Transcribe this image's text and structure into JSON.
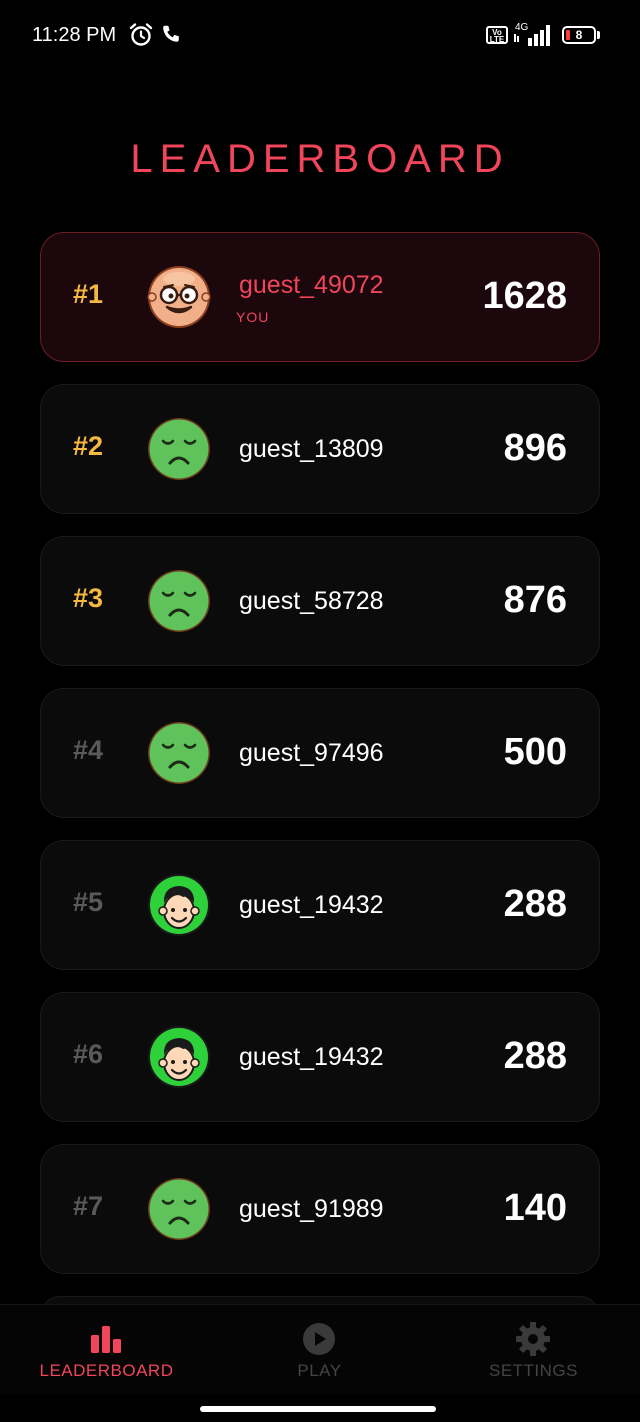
{
  "status_bar": {
    "time": "11:28 PM",
    "alarm_icon": "alarm-clock-icon",
    "call_icon": "phone-icon",
    "volte": "Vo LTE",
    "network": "4G",
    "battery": "8",
    "battery_color": "#ff3b3b"
  },
  "header": {
    "title": "LEADERBOARD"
  },
  "colors": {
    "accent": "#f0455a",
    "gold": "#f5b942",
    "muted": "#5a5a5a"
  },
  "players": [
    {
      "rank": "#1",
      "name": "guest_49072",
      "tag": "YOU",
      "score": "1628",
      "avatar": "glasses-face-avatar",
      "highlight": true
    },
    {
      "rank": "#2",
      "name": "guest_13809",
      "score": "896",
      "avatar": "sad-face-avatar"
    },
    {
      "rank": "#3",
      "name": "guest_58728",
      "score": "876",
      "avatar": "sad-face-avatar"
    },
    {
      "rank": "#4",
      "name": "guest_97496",
      "score": "500",
      "avatar": "sad-face-avatar"
    },
    {
      "rank": "#5",
      "name": "guest_19432",
      "score": "288",
      "avatar": "smiling-boy-avatar"
    },
    {
      "rank": "#6",
      "name": "guest_19432",
      "score": "288",
      "avatar": "smiling-boy-avatar"
    },
    {
      "rank": "#7",
      "name": "guest_91989",
      "score": "140",
      "avatar": "sad-face-avatar"
    }
  ],
  "bottom_nav": [
    {
      "label": "LEADERBOARD",
      "icon": "bar-chart-icon",
      "active": true
    },
    {
      "label": "PLAY",
      "icon": "play-icon",
      "active": false
    },
    {
      "label": "SETTINGS",
      "icon": "gear-icon",
      "active": false
    }
  ]
}
